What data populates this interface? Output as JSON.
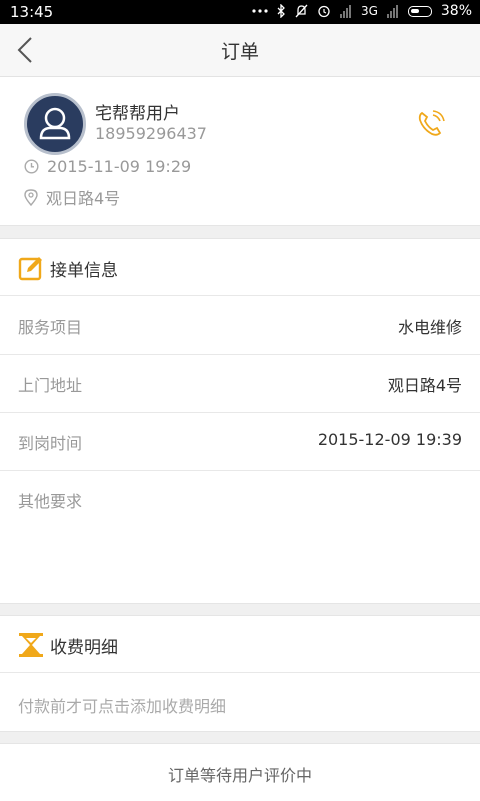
{
  "status_bar": {
    "time": "13:45",
    "signal": "3G",
    "battery": "38%"
  },
  "nav": {
    "title": "订单"
  },
  "user": {
    "name": "宅帮帮用户",
    "phone": "18959296437",
    "time": "2015-11-09 19:29",
    "address": "观日路4号"
  },
  "order_info": {
    "section_title": "接单信息",
    "rows": [
      {
        "label": "服务项目",
        "value": "水电维修"
      },
      {
        "label": "上门地址",
        "value": "观日路4号"
      },
      {
        "label": "到岗时间",
        "value": "2015-12-09 19:39"
      },
      {
        "label": "其他要求",
        "value": ""
      }
    ]
  },
  "fee": {
    "section_title": "收费明细",
    "hint": "付款前才可点击添加收费明细"
  },
  "footer": {
    "status": "订单等待用户评价中"
  },
  "colors": {
    "accent": "#f0a81a",
    "avatar": "#2a3c5f"
  }
}
